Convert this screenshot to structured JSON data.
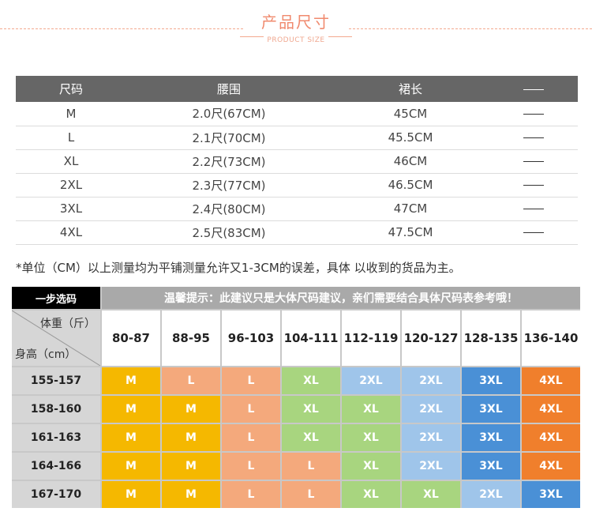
{
  "header": {
    "title": "产品尺寸",
    "subtitle": "PRODUCT SIZE"
  },
  "size_table": {
    "columns": [
      "尺码",
      "腰围",
      "裙长",
      "——"
    ],
    "rows": [
      [
        "M",
        "2.0尺(67CM)",
        "45CM",
        "——"
      ],
      [
        "L",
        "2.1尺(70CM)",
        "45.5CM",
        "——"
      ],
      [
        "XL",
        "2.2尺(73CM)",
        "46CM",
        "——"
      ],
      [
        "2XL",
        "2.3尺(77CM)",
        "46.5CM",
        "——"
      ],
      [
        "3XL",
        "2.4尺(80CM)",
        "47CM",
        "——"
      ],
      [
        "4XL",
        "2.5尺(83CM)",
        "47.5CM",
        "——"
      ]
    ]
  },
  "note": "*单位（CM）以上测量均为平铺测量允许又1-3CM的误差，具体 以收到的货品为主。",
  "recommend": {
    "step_label": "一步选码",
    "tip": "温馨提示：此建议只是大体尺码建议，亲们需要结合具体尺码表参考哦！",
    "weight_label": "体重（斤）",
    "height_label": "身高（cm）",
    "weights": [
      "80-87",
      "88-95",
      "96-103",
      "104-111",
      "112-119",
      "120-127",
      "128-135",
      "136-140"
    ],
    "heights": [
      "155-157",
      "158-160",
      "161-163",
      "164-166",
      "167-170"
    ],
    "grid": [
      [
        "M",
        "L",
        "L",
        "XL",
        "2XL",
        "2XL",
        "3XL",
        "4XL"
      ],
      [
        "M",
        "M",
        "L",
        "XL",
        "XL",
        "2XL",
        "3XL",
        "4XL"
      ],
      [
        "M",
        "M",
        "L",
        "XL",
        "XL",
        "2XL",
        "3XL",
        "4XL"
      ],
      [
        "M",
        "M",
        "L",
        "L",
        "XL",
        "2XL",
        "3XL",
        "4XL"
      ],
      [
        "M",
        "M",
        "L",
        "L",
        "XL",
        "XL",
        "2XL",
        "3XL"
      ]
    ],
    "colors": {
      "M": "#f5b800",
      "L": "#f4a97c",
      "XL": "#a8d57f",
      "2XL": "#9fc5ea",
      "3XL": "#4a90d6",
      "4XL": "#f07f2c"
    }
  }
}
